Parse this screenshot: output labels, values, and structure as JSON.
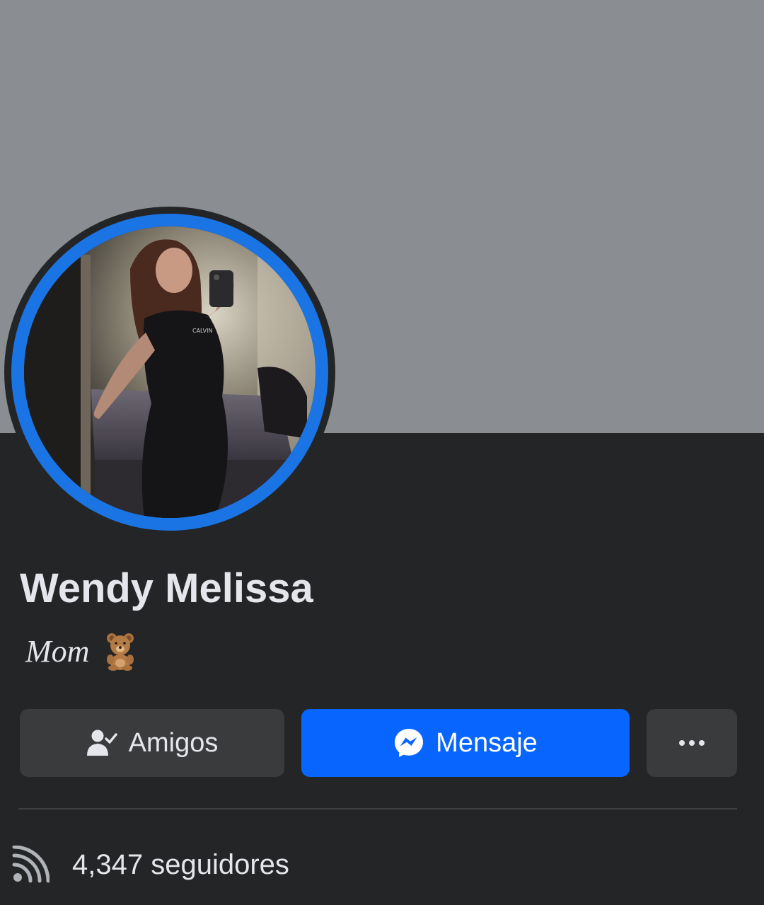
{
  "profile": {
    "name": "Wendy Melissa",
    "bio": "Mom",
    "bio_emoji": "teddy-bear-icon"
  },
  "actions": {
    "friends_label": "Amigos",
    "message_label": "Mensaje",
    "more_label": "more-options"
  },
  "stats": {
    "followers_count": "4,347",
    "followers_label": "seguidores"
  },
  "colors": {
    "cover": "#8a8d91",
    "background": "#242527",
    "accent": "#0866ff",
    "ring": "#1b74e4",
    "button_secondary": "#3a3b3c"
  }
}
